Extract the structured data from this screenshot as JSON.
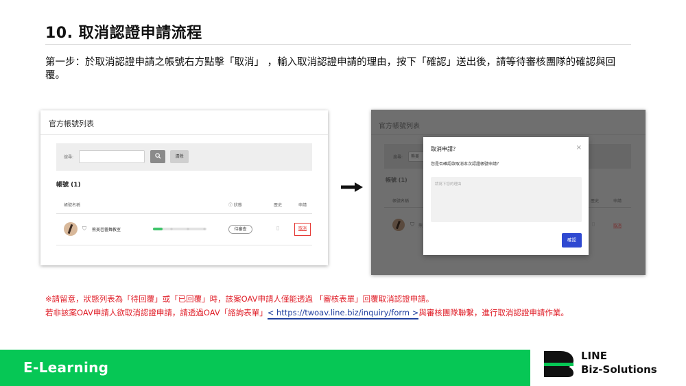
{
  "page": {
    "title": "10. 取消認證申請流程",
    "description": "第一步：於取消認證申請之帳號右方點擊「取消」 ，輸入取消認證申請的理由，按下「確認」送出後，請等待審核團隊的確認與回覆。"
  },
  "left_panel": {
    "title": "官方帳號列表",
    "search_label": "搜尋:",
    "search_icon": "search-icon",
    "clear_label": "清除",
    "accounts_header": "帳號 (1)",
    "columns": {
      "name": "帳號名稱",
      "status": "ⓘ 狀態",
      "history": "歷史",
      "apply": "申請"
    },
    "row": {
      "name": "熊美芭蕾舞教室",
      "status": "待審查",
      "cancel": "取消"
    }
  },
  "right_panel": {
    "title": "官方帳號列表",
    "search_label": "搜尋:",
    "search_value": "熊美",
    "accounts_header": "帳號 (1)",
    "columns": {
      "name": "帳號名稱",
      "history": "歷史",
      "apply": "申請"
    },
    "row": {
      "name_partial": "熊",
      "cancel": "取消"
    },
    "modal": {
      "title": "取消申請？",
      "close": "×",
      "question": "您是否確認欲取消本次認證帳號申請？",
      "placeholder": "請寫下您的理由",
      "confirm": "確認"
    }
  },
  "notes": {
    "line1": "※請留意，狀態列表為「待回覆」或「已回覆」時，該案OAV申請人僅能透過 「審核表單」回覆取消認證申請。",
    "line2_before": "若非該案OAV申請人欲取消認證申請，請透過OAV「諮詢表單」",
    "line2_link": "< https://twoav.line.biz/inquiry/form >",
    "line2_after": "與審核團隊聯繫，進行取消認證申請作業。"
  },
  "footer": {
    "label": "E-Learning",
    "brand_line1": "LINE",
    "brand_line2": "Biz-Solutions"
  },
  "colors": {
    "line_green": "#06c755",
    "alert_red": "#e0202a",
    "link_blue": "#1f3f9e",
    "confirm_blue": "#2f49d1"
  }
}
